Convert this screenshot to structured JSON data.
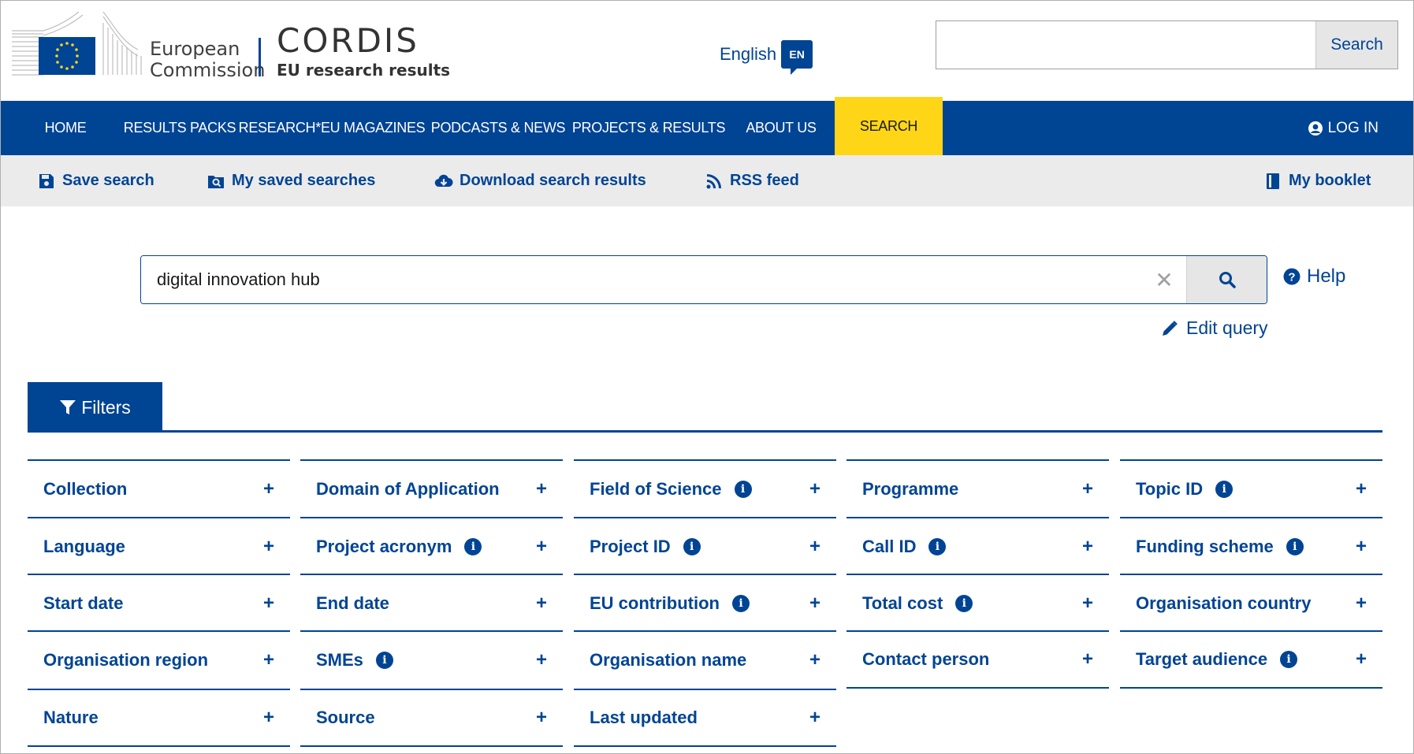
{
  "header": {
    "ec_text_line1": "European",
    "ec_text_line2": "Commission",
    "site_title": "CORDIS",
    "site_subtitle": "EU research results",
    "language_label": "English",
    "language_code": "EN",
    "search_placeholder": "",
    "search_button": "Search"
  },
  "nav": {
    "items": [
      {
        "label": "HOME"
      },
      {
        "label": "RESULTS PACKS"
      },
      {
        "label": "RESEARCH*EU MAGAZINES"
      },
      {
        "label": "PODCASTS & NEWS"
      },
      {
        "label": "PROJECTS & RESULTS"
      },
      {
        "label": "ABOUT US"
      },
      {
        "label": "SEARCH",
        "active": true
      }
    ],
    "login": "LOG IN"
  },
  "toolbar": {
    "save_search": "Save search",
    "saved_searches": "My saved searches",
    "download": "Download search results",
    "rss": "RSS feed",
    "booklet": "My booklet"
  },
  "search": {
    "query": "digital innovation hub",
    "clear": "✕",
    "help": "Help",
    "edit_query": "Edit query"
  },
  "filters": {
    "tab_label": "Filters",
    "rows": [
      [
        {
          "label": "Collection",
          "info": false
        },
        {
          "label": "Domain of Application",
          "info": false
        },
        {
          "label": "Field of Science",
          "info": true
        },
        {
          "label": "Programme",
          "info": false
        },
        {
          "label": "Topic ID",
          "info": true
        }
      ],
      [
        {
          "label": "Language",
          "info": false
        },
        {
          "label": "Project acronym",
          "info": true
        },
        {
          "label": "Project ID",
          "info": true
        },
        {
          "label": "Call ID",
          "info": true
        },
        {
          "label": "Funding scheme",
          "info": true
        }
      ],
      [
        {
          "label": "Start date",
          "info": false
        },
        {
          "label": "End date",
          "info": false
        },
        {
          "label": "EU contribution",
          "info": true
        },
        {
          "label": "Total cost",
          "info": true
        },
        {
          "label": "Organisation country",
          "info": false
        }
      ],
      [
        {
          "label": "Organisation region",
          "info": false
        },
        {
          "label": "SMEs",
          "info": true
        },
        {
          "label": "Organisation name",
          "info": false
        },
        {
          "label": "Contact person",
          "info": false
        },
        {
          "label": "Target audience",
          "info": true
        }
      ],
      [
        {
          "label": "Nature",
          "info": false
        },
        {
          "label": "Source",
          "info": false
        },
        {
          "label": "Last updated",
          "info": false
        }
      ]
    ],
    "plus_symbol": "+",
    "info_symbol": "i"
  },
  "colors": {
    "brand_blue": "#004494",
    "active_yellow": "#ffd617",
    "toolbar_gray": "#ebebeb"
  }
}
